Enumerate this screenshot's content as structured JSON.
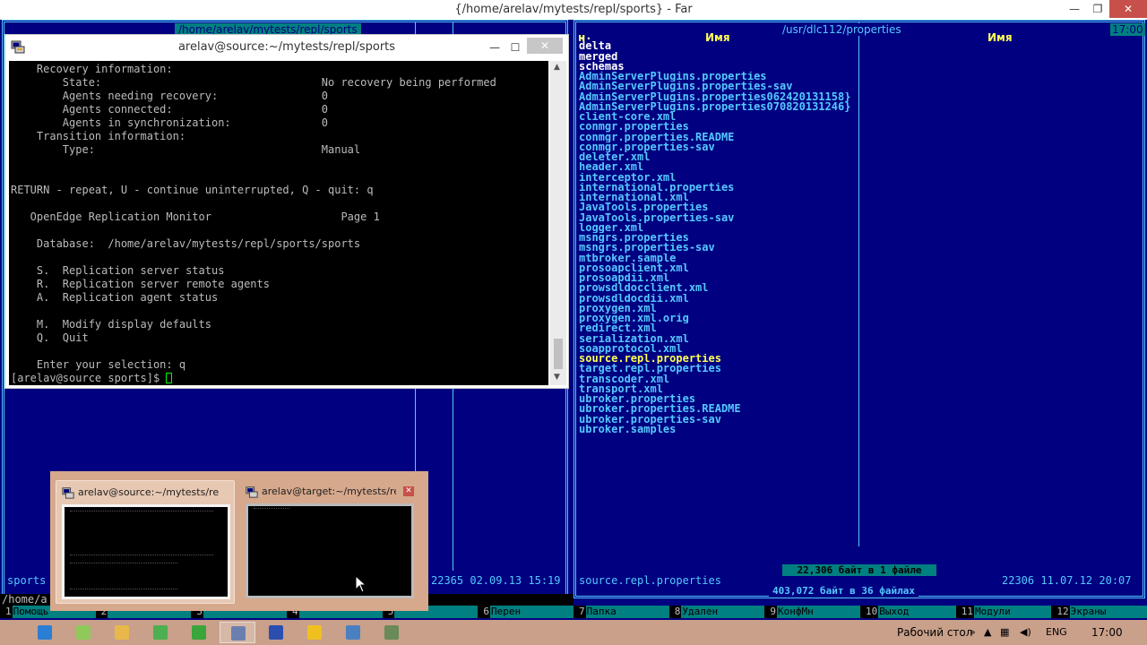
{
  "far": {
    "title": "{/home/arelav/mytests/repl/sports} - Far",
    "left_path": "/home/arelav/mytests/repl/sports",
    "right_path": "/usr/dlc112/properties",
    "clock": "17:00",
    "col_header_n": "н",
    "col_header_name": "Имя",
    "left_status": "22365 02.09.13 15:19",
    "left_name": "sports",
    "right_selected_name": "source.repl.properties",
    "right_status_info": "22306 11.07.12 20:07",
    "selection_info": "22,306 байт в 1 файле",
    "total_info": "403,072 байт в 36 файлах",
    "left_header_fragment": "Р",
    "cmdline": "/home/a",
    "files": [
      {
        "name": "..",
        "type": "dir"
      },
      {
        "name": "delta",
        "type": "dir"
      },
      {
        "name": "merged",
        "type": "dir"
      },
      {
        "name": "schemas",
        "type": "dir"
      },
      {
        "name": "AdminServerPlugins.properties",
        "type": "file"
      },
      {
        "name": "AdminServerPlugins.properties-sav",
        "type": "file"
      },
      {
        "name": "AdminServerPlugins.properties062420131158}",
        "type": "file"
      },
      {
        "name": "AdminServerPlugins.properties070820131246}",
        "type": "file"
      },
      {
        "name": "client-core.xml",
        "type": "file"
      },
      {
        "name": "conmgr.properties",
        "type": "file"
      },
      {
        "name": "conmgr.properties.README",
        "type": "file"
      },
      {
        "name": "conmgr.properties-sav",
        "type": "file"
      },
      {
        "name": "deleter.xml",
        "type": "file"
      },
      {
        "name": "header.xml",
        "type": "file"
      },
      {
        "name": "interceptor.xml",
        "type": "file"
      },
      {
        "name": "international.properties",
        "type": "file"
      },
      {
        "name": "international.xml",
        "type": "file"
      },
      {
        "name": "JavaTools.properties",
        "type": "file"
      },
      {
        "name": "JavaTools.properties-sav",
        "type": "file"
      },
      {
        "name": "logger.xml",
        "type": "file"
      },
      {
        "name": "msngrs.properties",
        "type": "file"
      },
      {
        "name": "msngrs.properties-sav",
        "type": "file"
      },
      {
        "name": "mtbroker.sample",
        "type": "file"
      },
      {
        "name": "prosoapclient.xml",
        "type": "file"
      },
      {
        "name": "prosoapdii.xml",
        "type": "file"
      },
      {
        "name": "prowsdldocclient.xml",
        "type": "file"
      },
      {
        "name": "prowsdldocdii.xml",
        "type": "file"
      },
      {
        "name": "proxygen.xml",
        "type": "file"
      },
      {
        "name": "proxygen.xml.orig",
        "type": "file"
      },
      {
        "name": "redirect.xml",
        "type": "file"
      },
      {
        "name": "serialization.xml",
        "type": "file"
      },
      {
        "name": "soapprotocol.xml",
        "type": "file"
      },
      {
        "name": "source.repl.properties",
        "type": "selected"
      },
      {
        "name": "target.repl.properties",
        "type": "file"
      },
      {
        "name": "transcoder.xml",
        "type": "file"
      },
      {
        "name": "transport.xml",
        "type": "file"
      },
      {
        "name": "ubroker.properties",
        "type": "file"
      },
      {
        "name": "ubroker.properties.README",
        "type": "file"
      },
      {
        "name": "ubroker.properties-sav",
        "type": "file"
      },
      {
        "name": "ubroker.samples",
        "type": "file"
      }
    ],
    "fkeys": [
      {
        "num": "1",
        "label": "Помощь"
      },
      {
        "num": "2",
        "label": ""
      },
      {
        "num": "3",
        "label": ""
      },
      {
        "num": "4",
        "label": ""
      },
      {
        "num": "5",
        "label": ""
      },
      {
        "num": "6",
        "label": "Перен"
      },
      {
        "num": "7",
        "label": "Папка"
      },
      {
        "num": "8",
        "label": "Удален"
      },
      {
        "num": "9",
        "label": "КонфМн"
      },
      {
        "num": "10",
        "label": "Выход"
      },
      {
        "num": "11",
        "label": "Модули"
      },
      {
        "num": "12",
        "label": "Экраны"
      }
    ]
  },
  "putty": {
    "title": "arelav@source:~/mytests/repl/sports",
    "lines": [
      "    Recovery information:",
      "        State:                                  No recovery being performed",
      "        Agents needing recovery:                0",
      "        Agents connected:                       0",
      "        Agents in synchronization:              0",
      "    Transition information:",
      "        Type:                                   Manual",
      "",
      "",
      "RETURN - repeat, U - continue uninterrupted, Q - quit: q",
      "",
      "   OpenEdge Replication Monitor                    Page 1",
      "",
      "    Database:  /home/arelav/mytests/repl/sports/sports",
      "",
      "    S.  Replication server status",
      "    R.  Replication server remote agents",
      "    A.  Replication agent status",
      "",
      "    M.  Modify display defaults",
      "    Q.  Quit",
      "",
      "    Enter your selection: q"
    ],
    "prompt": "[arelav@source sports]$ "
  },
  "thumbnails": [
    {
      "title": "arelav@source:~/mytests/repl/s..."
    },
    {
      "title": "arelav@target:~/mytests/re..."
    }
  ],
  "taskbar": {
    "desktop_label": "Рабочий стол",
    "lang": "ENG",
    "clock": "17:00",
    "apps": [
      {
        "name": "ie",
        "color": "#2a7fd4"
      },
      {
        "name": "notepad",
        "color": "#8fc95a"
      },
      {
        "name": "explorer",
        "color": "#e8b84a"
      },
      {
        "name": "chrome",
        "color": "#4caf50"
      },
      {
        "name": "green-app",
        "color": "#3aa53a"
      },
      {
        "name": "putty",
        "color": "#6a7fb0"
      },
      {
        "name": "far",
        "color": "#2a4fb0"
      },
      {
        "name": "outlook",
        "color": "#f0c020"
      },
      {
        "name": "virtualbox",
        "color": "#4a80c0"
      },
      {
        "name": "network",
        "color": "#6a8a5a"
      }
    ]
  },
  "colors": {
    "far_bg": "#000080",
    "far_frame": "#55c8ff",
    "far_selected": "#ffff55",
    "taskbar": "#c9a08a"
  }
}
